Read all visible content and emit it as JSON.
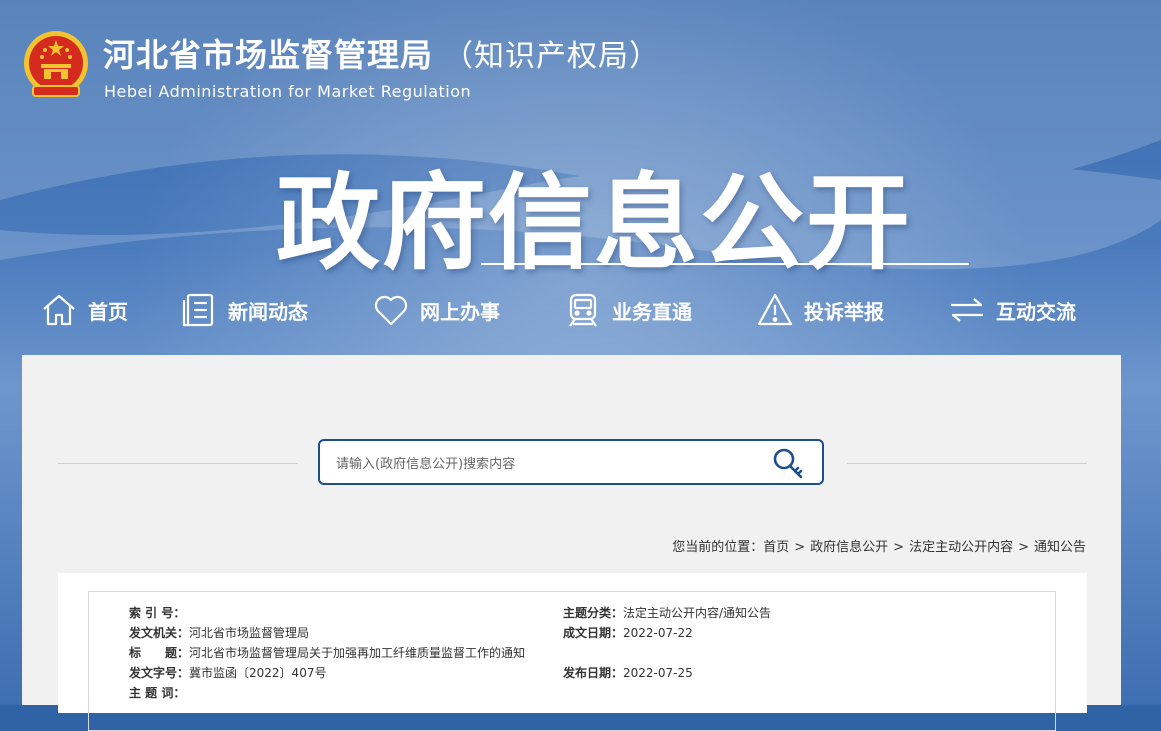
{
  "header": {
    "title": "河北省市场监督管理局",
    "title_suffix": "（知识产权局）",
    "title_en": "Hebei Administration for Market Regulation",
    "banner_title": "政府信息公开"
  },
  "nav": {
    "items": [
      {
        "label": "首页",
        "icon": "home-icon"
      },
      {
        "label": "新闻动态",
        "icon": "document-icon"
      },
      {
        "label": "网上办事",
        "icon": "heart-icon"
      },
      {
        "label": "业务直通",
        "icon": "train-icon"
      },
      {
        "label": "投诉举报",
        "icon": "warning-icon"
      },
      {
        "label": "互动交流",
        "icon": "exchange-icon"
      }
    ]
  },
  "search": {
    "placeholder": "请输入(政府信息公开)搜索内容",
    "icon": "key-search-icon"
  },
  "breadcrumb": {
    "prefix": "您当前的位置：",
    "items": [
      "首页",
      "政府信息公开",
      "法定主动公开内容",
      "通知公告"
    ],
    "separator": ">"
  },
  "info": {
    "index_label": "索 引 号：",
    "index_value": "",
    "topic_label": "主题分类：",
    "topic_value": "法定主动公开内容/通知公告",
    "issuer_label": "发文机关：",
    "issuer_value": "河北省市场监督管理局",
    "created_label": "成文日期：",
    "created_value": "2022-07-22",
    "title_label": "标　　题：",
    "title_value": "河北省市场监督管理局关于加强再加工纤维质量监督工作的通知",
    "docno_label": "发文字号：",
    "docno_value": "冀市监函〔2022〕407号",
    "published_label": "发布日期：",
    "published_value": "2022-07-25",
    "keywords_label": "主 题 词：",
    "keywords_value": ""
  },
  "colors": {
    "banner_blue": "#3568ad",
    "search_border": "#1d4d8d",
    "panel_bg": "#f1f1f1",
    "emblem_red": "#d52b1e",
    "emblem_gold": "#f4c430"
  }
}
